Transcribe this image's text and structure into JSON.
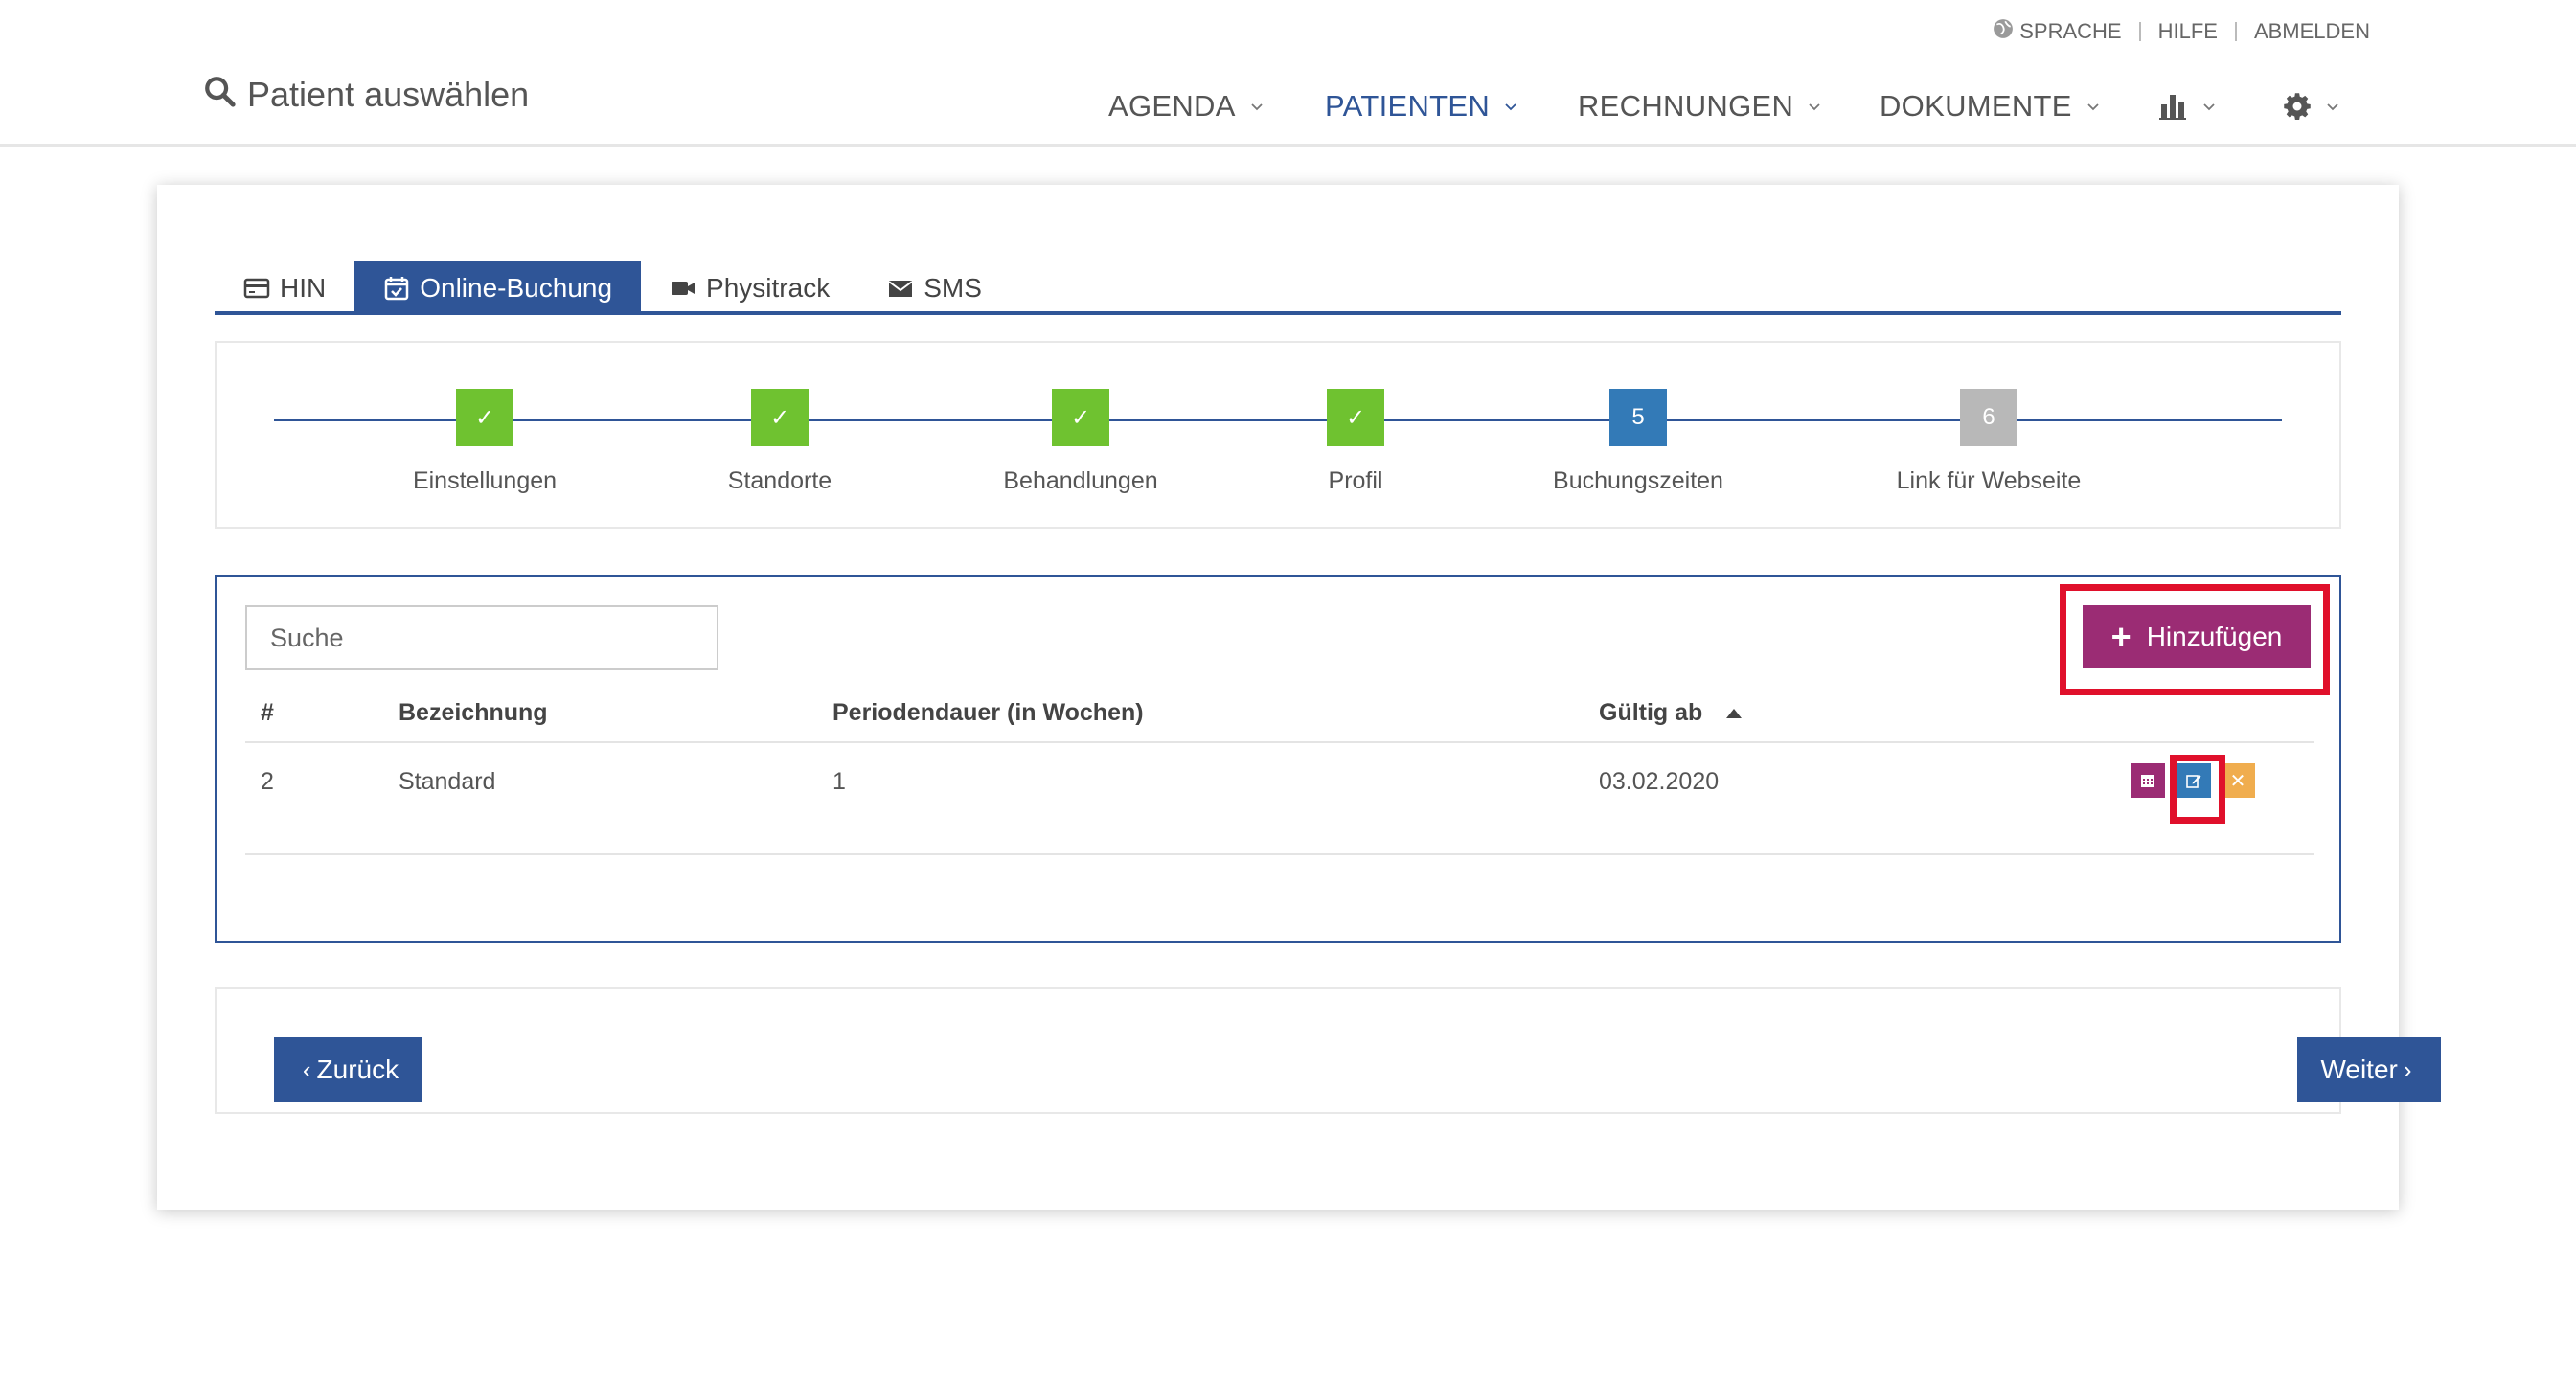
{
  "colors": {
    "primary": "#2f5597",
    "success": "#6fc230",
    "current_step": "#337ab7",
    "pending_step": "#b8b8b8",
    "add_button": "#9b2c74",
    "delete_button": "#f0ad4e",
    "highlight_outline": "#e0102b"
  },
  "utility_links": {
    "language": "SPRACHE",
    "help": "HILFE",
    "logout": "ABMELDEN"
  },
  "header": {
    "patient_select": "Patient auswählen"
  },
  "nav": {
    "items": [
      {
        "label": "AGENDA",
        "active": false
      },
      {
        "label": "PATIENTEN",
        "active": true
      },
      {
        "label": "RECHNUNGEN",
        "active": false
      },
      {
        "label": "DOKUMENTE",
        "active": false
      }
    ],
    "icons": [
      "bar-chart-icon",
      "gear-icon"
    ]
  },
  "tabs": [
    {
      "label": "HIN",
      "icon": "card-icon",
      "active": false
    },
    {
      "label": "Online-Buchung",
      "icon": "calendar-check-icon",
      "active": true
    },
    {
      "label": "Physitrack",
      "icon": "video-camera-icon",
      "active": false
    },
    {
      "label": "SMS",
      "icon": "envelope-icon",
      "active": false
    }
  ],
  "steps": [
    {
      "marker": "✓",
      "label": "Einstellungen",
      "state": "done"
    },
    {
      "marker": "✓",
      "label": "Standorte",
      "state": "done"
    },
    {
      "marker": "✓",
      "label": "Behandlungen",
      "state": "done"
    },
    {
      "marker": "✓",
      "label": "Profil",
      "state": "done"
    },
    {
      "marker": "5",
      "label": "Buchungszeiten",
      "state": "current"
    },
    {
      "marker": "6",
      "label": "Link für Webseite",
      "state": "todo"
    }
  ],
  "search": {
    "placeholder": "Suche"
  },
  "add_button": {
    "label": "Hinzufügen"
  },
  "table": {
    "columns": [
      "#",
      "Bezeichnung",
      "Periodendauer (in Wochen)",
      "Gültig ab"
    ],
    "sort_column": "Gültig ab",
    "sort_direction": "ascending",
    "rows": [
      {
        "id": "2",
        "name": "Standard",
        "period_weeks": "1",
        "valid_from": "03.02.2020"
      }
    ],
    "row_actions": [
      "calendar-icon",
      "edit-icon",
      "delete-icon"
    ]
  },
  "footer": {
    "back": "Zurück",
    "next": "Weiter"
  }
}
